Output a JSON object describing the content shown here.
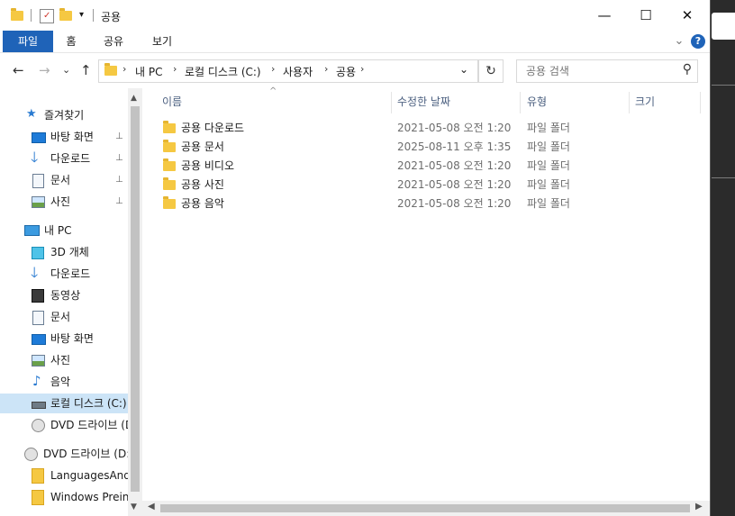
{
  "titlebar": {
    "title": "공용",
    "qa_dropdown": "▾",
    "minimize": "—",
    "maximize": "☐",
    "close": "✕"
  },
  "ribbon": {
    "tabs": [
      {
        "label": "파일",
        "active": true
      },
      {
        "label": "홈",
        "active": false
      },
      {
        "label": "공유",
        "active": false
      },
      {
        "label": "보기",
        "active": false
      }
    ],
    "expand": "⌄",
    "help": "?"
  },
  "toolbar": {
    "back": "←",
    "forward": "→",
    "recent": "⌄",
    "up": "↑",
    "breadcrumb": [
      "내 PC",
      "로컬 디스크 (C:)",
      "사용자",
      "공용"
    ],
    "address_dropdown": "⌄",
    "refresh": "↻",
    "search_placeholder": "공용 검색",
    "search_icon": "⚲"
  },
  "nav": {
    "quick_access": {
      "label": "즐겨찾기",
      "items": [
        {
          "label": "바탕 화면",
          "icon": "desktop-icon",
          "pinned": true
        },
        {
          "label": "다운로드",
          "icon": "download-icon",
          "pinned": true
        },
        {
          "label": "문서",
          "icon": "document-icon",
          "pinned": true
        },
        {
          "label": "사진",
          "icon": "picture-icon",
          "pinned": true
        }
      ]
    },
    "this_pc": {
      "label": "내 PC",
      "items": [
        {
          "label": "3D 개체",
          "icon": "3d-objects-icon"
        },
        {
          "label": "다운로드",
          "icon": "download-icon"
        },
        {
          "label": "동영상",
          "icon": "video-icon"
        },
        {
          "label": "문서",
          "icon": "document-icon"
        },
        {
          "label": "바탕 화면",
          "icon": "desktop-icon"
        },
        {
          "label": "사진",
          "icon": "picture-icon"
        },
        {
          "label": "음악",
          "icon": "music-icon"
        },
        {
          "label": "로컬 디스크 (C:)",
          "icon": "drive-icon",
          "selected": true
        },
        {
          "label": "DVD 드라이브 (D:)",
          "icon": "dvd-icon"
        }
      ]
    },
    "dvd": {
      "label": "DVD 드라이브 (D:)",
      "items": [
        {
          "label": "LanguagesAndOptionalFeatures",
          "icon": "folder-icon"
        },
        {
          "label": "Windows Preinstall",
          "icon": "folder-icon"
        }
      ]
    },
    "pin_glyph": "📌"
  },
  "content": {
    "columns": [
      "이름",
      "수정한 날짜",
      "유형",
      "크기"
    ],
    "sort_indicator": "^",
    "rows": [
      {
        "name": "공용 다운로드",
        "date": "2021-05-08 오전 1:20",
        "type": "파일 폴더"
      },
      {
        "name": "공용 문서",
        "date": "2025-08-11 오후 1:35",
        "type": "파일 폴더"
      },
      {
        "name": "공용 비디오",
        "date": "2021-05-08 오전 1:20",
        "type": "파일 폴더"
      },
      {
        "name": "공용 사진",
        "date": "2021-05-08 오전 1:20",
        "type": "파일 폴더"
      },
      {
        "name": "공용 음악",
        "date": "2021-05-08 오전 1:20",
        "type": "파일 폴더"
      }
    ]
  },
  "colors": {
    "accent": "#1f63b8",
    "selection": "#cce4f7",
    "folder": "#f5c842"
  }
}
